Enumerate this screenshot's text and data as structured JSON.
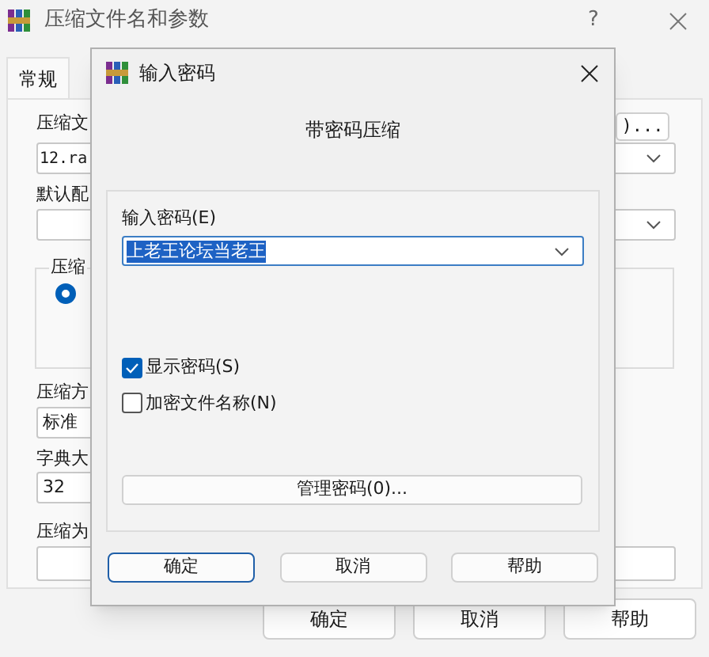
{
  "main_window": {
    "title": "压缩文件名和参数",
    "help": "?",
    "tabs": [
      {
        "label": "常规",
        "selected": true
      }
    ],
    "archive_name": {
      "label": "压缩文",
      "value": "12.ra",
      "browse_button": ")..."
    },
    "profile": {
      "label": "默认配"
    },
    "format_group": {
      "label": "压缩",
      "options": [
        {
          "selected": true
        }
      ]
    },
    "method": {
      "label": "压缩方",
      "value": "标准"
    },
    "dictionary": {
      "label": "字典大",
      "value": "32"
    },
    "split": {
      "label": "压缩为"
    },
    "buttons": [
      "确定",
      "取消",
      "帮助"
    ]
  },
  "password_dialog": {
    "title": "输入密码",
    "heading": "带密码压缩",
    "password_label": "输入密码(E)",
    "password": "上老王论坛当老王",
    "text_selected": true,
    "options": [
      {
        "label": "显示密码(S)",
        "checked": true
      },
      {
        "label": "加密文件名称(N)",
        "checked": false
      }
    ],
    "manage_button": "管理密码(0)...",
    "buttons": [
      {
        "label": "确定",
        "default": true
      },
      {
        "label": "取消",
        "default": false
      },
      {
        "label": "帮助",
        "default": false
      }
    ]
  }
}
